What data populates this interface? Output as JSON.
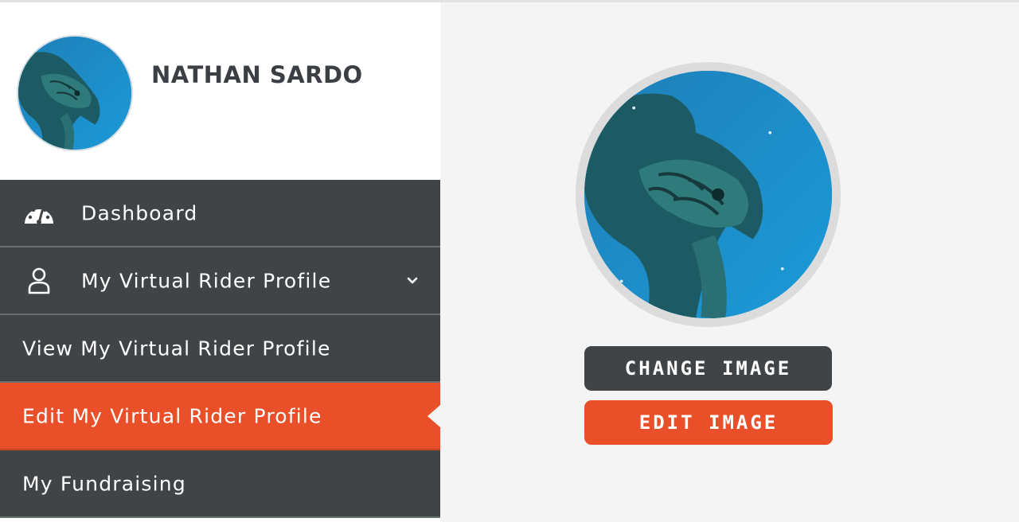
{
  "user": {
    "name": "NATHAN SARDO",
    "avatar_icon": "sea-turtle-photo"
  },
  "nav": {
    "items": [
      {
        "label": "Dashboard",
        "icon": "dashboard-gauge-icon"
      },
      {
        "label": "My Virtual Rider Profile",
        "icon": "user-icon",
        "expanded": true
      },
      {
        "label": "View My Virtual Rider Profile"
      },
      {
        "label": "Edit My Virtual Rider Profile",
        "active": true
      },
      {
        "label": "My Fundraising"
      }
    ]
  },
  "main": {
    "change_image_label": "CHANGE IMAGE",
    "edit_image_label": "EDIT IMAGE"
  },
  "colors": {
    "nav_bg": "#404447",
    "accent": "#e9502a",
    "page_bg": "#f4f4f4"
  }
}
